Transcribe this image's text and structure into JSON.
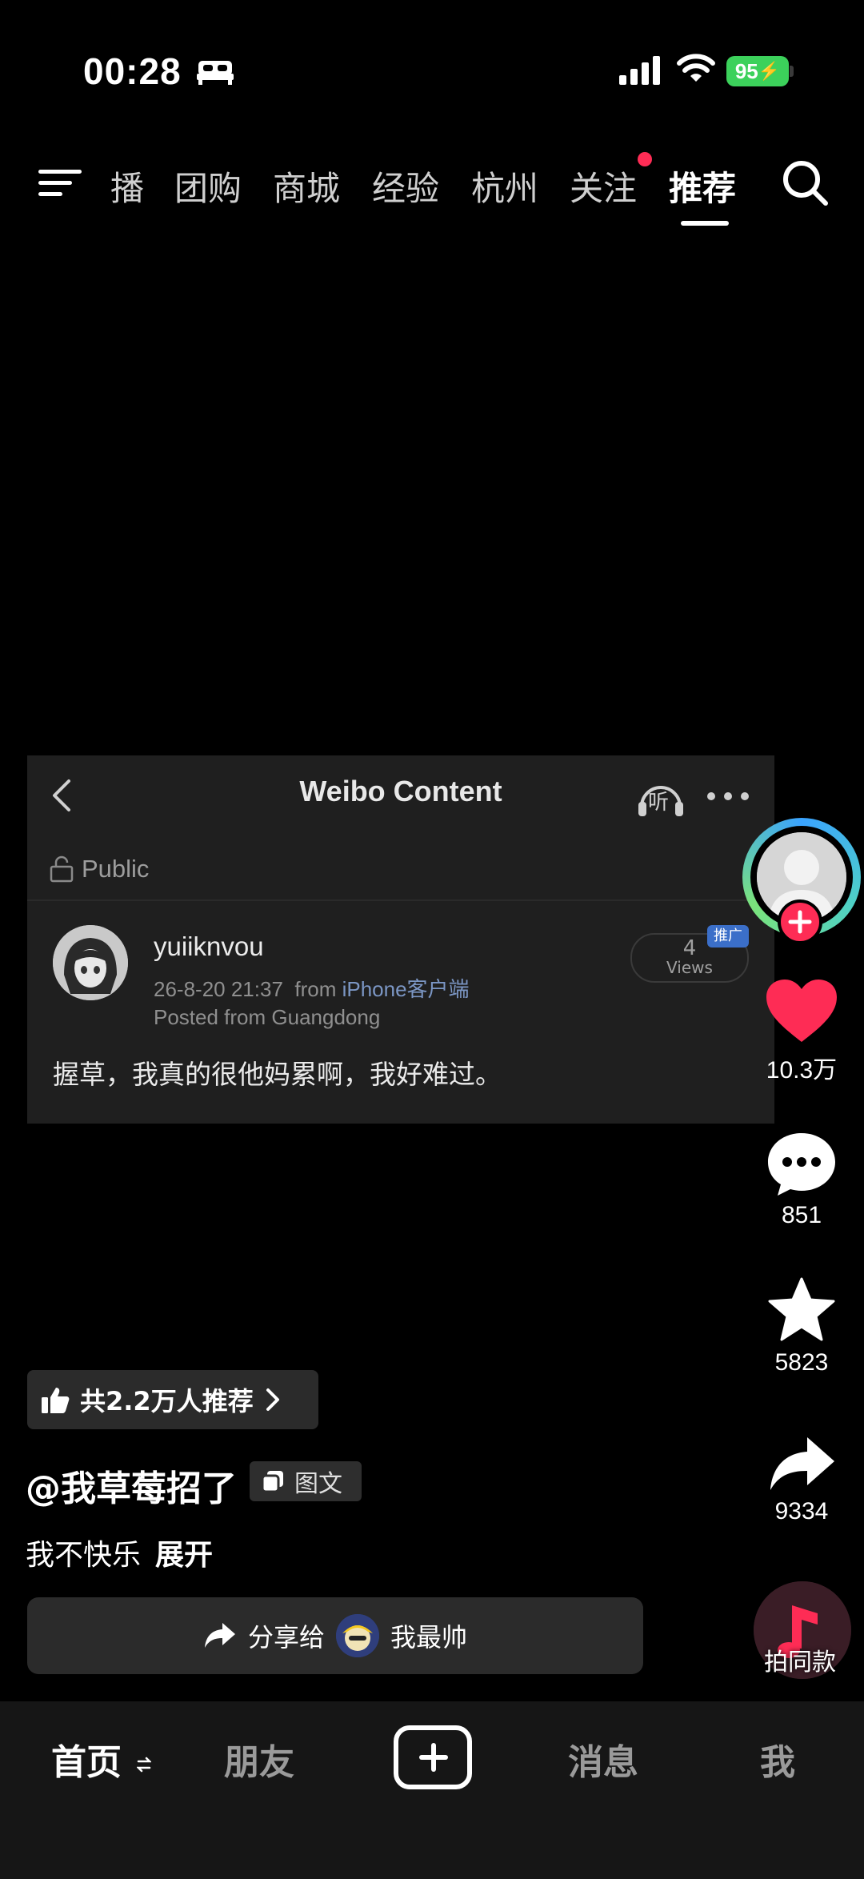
{
  "status_bar": {
    "time": "00:28",
    "battery": "95",
    "icons": [
      "bed-icon",
      "signal-icon",
      "wifi-icon",
      "battery-icon"
    ]
  },
  "top_nav": {
    "tabs": [
      {
        "label": "播"
      },
      {
        "label": "团购"
      },
      {
        "label": "商城"
      },
      {
        "label": "经验"
      },
      {
        "label": "杭州"
      },
      {
        "label": "关注"
      },
      {
        "label": "推荐"
      }
    ],
    "active_tab": "推荐",
    "notification_dot_color": "#fe2c55"
  },
  "weibo_card": {
    "title": "Weibo Content",
    "listen_label": "听",
    "visibility": "Public",
    "username": "yuiiknvou",
    "date": "26-8-20 21:37",
    "from_prefix": "from",
    "source": "iPhone客户端",
    "location": "Posted from Guangdong",
    "views_count": "4",
    "views_label": "Views",
    "promo_badge": "推广",
    "body": "握草，我真的很他妈累啊，我好难过。"
  },
  "right_rail": {
    "likes": "10.3万",
    "comments": "851",
    "favorites": "5823",
    "shares": "9334",
    "music_label": "拍同款",
    "accent_color": "#fe2c55"
  },
  "video_info": {
    "recommend_text": "共2.2万人推荐",
    "author": "@我草莓招了",
    "type_label": "图文",
    "caption": "我不快乐",
    "expand_label": "展开",
    "share_prefix": "分享给",
    "share_target": "我最帅"
  },
  "bottom_tabs": {
    "home": "首页",
    "friends": "朋友",
    "messages": "消息",
    "me": "我"
  }
}
